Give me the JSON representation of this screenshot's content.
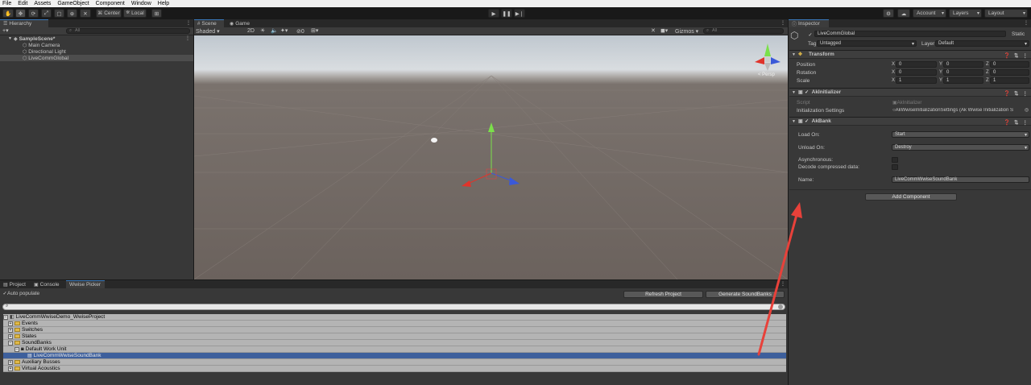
{
  "menu": [
    "File",
    "Edit",
    "Assets",
    "GameObject",
    "Component",
    "Window",
    "Help"
  ],
  "toolbar": {
    "pivot": "Center",
    "space": "Local",
    "account": "Account",
    "layers": "Layers",
    "layout": "Layout"
  },
  "hierarchy": {
    "tab": "Hierarchy",
    "search_placeholder": "All",
    "scene": "SampleScene*",
    "items": [
      "Main Camera",
      "Directional Light",
      "LiveCommGlobal"
    ]
  },
  "scene": {
    "tabs": [
      "Scene",
      "Game"
    ],
    "shading": "Shaded",
    "mode2d": "2D",
    "hidden_count": "0",
    "gizmos": "Gizmos",
    "search_placeholder": "All",
    "persp": "< Persp"
  },
  "inspector": {
    "tab": "Inspector",
    "object_name": "LiveCommGlobal",
    "static": "Static",
    "tag_label": "Tag",
    "tag": "Untagged",
    "layer_label": "Layer",
    "layer": "Default",
    "transform": {
      "title": "Transform",
      "rows": [
        {
          "label": "Position",
          "x": "0",
          "y": "0",
          "z": "0"
        },
        {
          "label": "Rotation",
          "x": "0",
          "y": "0",
          "z": "0"
        },
        {
          "label": "Scale",
          "x": "1",
          "y": "1",
          "z": "1"
        }
      ]
    },
    "akinit": {
      "title": "AkInitializer",
      "script_label": "Script",
      "script_value": "AkInitializer",
      "settings_label": "Initialization Settings",
      "settings_value": "AkWwiseInitializationSettings (Ak Wwise Initialization S"
    },
    "akbank": {
      "title": "AkBank",
      "load_on_label": "Load On:",
      "load_on": "Start",
      "unload_on_label": "Unload On:",
      "unload_on": "Destroy",
      "async_label": "Asynchronous:",
      "decode_label": "Decode compressed data:",
      "name_label": "Name:",
      "name": "LiveCommWwiseSoundBank"
    },
    "add_component": "Add Component"
  },
  "bottom": {
    "tabs": [
      "Project",
      "Console",
      "Wwise Picker"
    ],
    "auto_populate": "Auto populate",
    "refresh": "Refresh Project",
    "generate": "Generate SoundBanks",
    "tree": [
      {
        "label": "LiveCommWwiseDemo_WwiseProject",
        "depth": 0
      },
      {
        "label": "Events",
        "depth": 1
      },
      {
        "label": "Switches",
        "depth": 1
      },
      {
        "label": "States",
        "depth": 1
      },
      {
        "label": "SoundBanks",
        "depth": 1
      },
      {
        "label": "Default Work Unit",
        "depth": 2
      },
      {
        "label": "LiveCommWwiseSoundBank",
        "depth": 3,
        "selected": true
      },
      {
        "label": "Auxiliary Busses",
        "depth": 1
      },
      {
        "label": "Virtual Acoustics",
        "depth": 1
      }
    ]
  },
  "colors": {
    "accent": "#3a79bb",
    "selection": "#3d5f9c",
    "annotation_arrow": "#e8413a"
  }
}
